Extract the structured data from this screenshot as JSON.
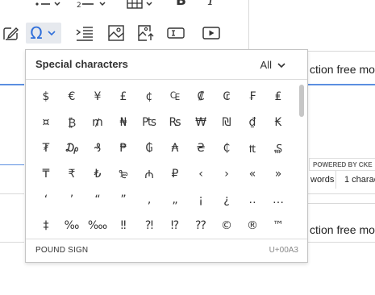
{
  "editor": {
    "line1_text": "ction free mo",
    "line2_text": "ction free mo",
    "powered_by": "POWERED BY CKE",
    "word_count": "words",
    "char_count": "1 charac"
  },
  "special_chars": {
    "title": "Special characters",
    "filter_value": "All",
    "characters": [
      "$",
      "€",
      "¥",
      "£",
      "¢",
      "₠",
      "₡",
      "₢",
      "₣",
      "₤",
      "¤",
      "₿",
      "₥",
      "₦",
      "₧",
      "₨",
      "₩",
      "₪",
      "₫",
      "₭",
      "₮",
      "₯",
      "₰",
      "₱",
      "₲",
      "₳",
      "₴",
      "₵",
      "₶",
      "₷",
      "₸",
      "₹",
      "₺",
      "₻",
      "₼",
      "₽",
      "‹",
      "›",
      "«",
      "»",
      "‘",
      "’",
      "“",
      "”",
      "‚",
      "„",
      "¡",
      "¿",
      "‥",
      "…",
      "‡",
      "‰",
      "‱",
      "‼",
      "⁈",
      "⁉",
      "⁇",
      "©",
      "®",
      "™"
    ],
    "selected_name": "POUND SIGN",
    "selected_code": "U+00A3"
  },
  "colors": {
    "accent": "#2f6fda",
    "border": "#c4c4c4"
  },
  "icons": [
    "bullet-list-icon",
    "numbered-list-icon",
    "table-icon",
    "bold-icon",
    "italic-icon",
    "edit-icon",
    "omega-icon",
    "chevron-down-icon",
    "indent-icon",
    "image-icon",
    "upload-image-icon",
    "text-field-icon",
    "video-icon"
  ]
}
